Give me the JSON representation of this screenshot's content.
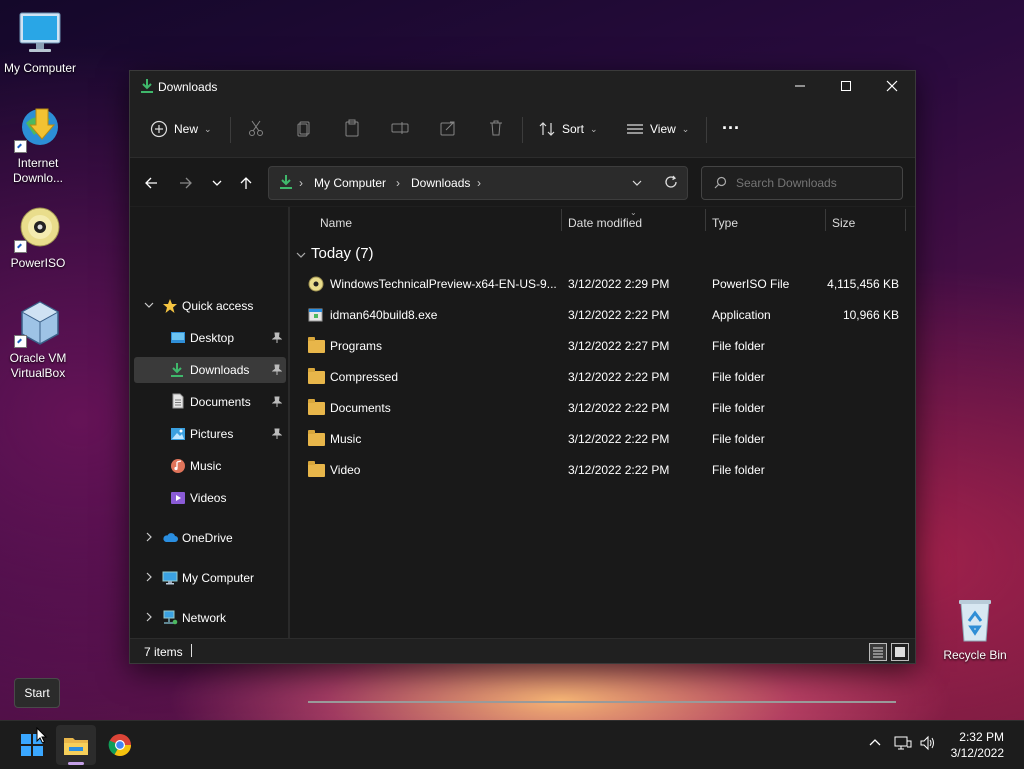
{
  "desktop": {
    "icons": [
      {
        "label": "My Computer"
      },
      {
        "label": "Internet Downlo..."
      },
      {
        "label": "PowerISO"
      },
      {
        "label": "Oracle VM VirtualBox"
      },
      {
        "label": "Recycle Bin"
      }
    ]
  },
  "window": {
    "title": "Downloads",
    "toolbar": {
      "new_label": "New",
      "sort_label": "Sort",
      "view_label": "View",
      "more_label": "..."
    },
    "address": {
      "crumbs": [
        "My Computer",
        "Downloads"
      ]
    },
    "search": {
      "placeholder": "Search Downloads"
    },
    "nav": {
      "quick_access": "Quick access",
      "items": [
        {
          "label": "Desktop",
          "pinned": true
        },
        {
          "label": "Downloads",
          "pinned": true,
          "selected": true
        },
        {
          "label": "Documents",
          "pinned": true
        },
        {
          "label": "Pictures",
          "pinned": true
        },
        {
          "label": "Music",
          "pinned": false
        },
        {
          "label": "Videos",
          "pinned": false
        }
      ],
      "onedrive": "OneDrive",
      "my_computer": "My Computer",
      "network": "Network"
    },
    "columns": {
      "name": "Name",
      "date": "Date modified",
      "type": "Type",
      "size": "Size"
    },
    "group_label": "Today (7)",
    "files": [
      {
        "name": "WindowsTechnicalPreview-x64-EN-US-9...",
        "date": "3/12/2022 2:29 PM",
        "type": "PowerISO File",
        "size": "4,115,456 KB",
        "icon": "disc-icon"
      },
      {
        "name": "idman640build8.exe",
        "date": "3/12/2022 2:22 PM",
        "type": "Application",
        "size": "10,966 KB",
        "icon": "exe-icon"
      },
      {
        "name": "Programs",
        "date": "3/12/2022 2:27 PM",
        "type": "File folder",
        "size": "",
        "icon": "folder-icon"
      },
      {
        "name": "Compressed",
        "date": "3/12/2022 2:22 PM",
        "type": "File folder",
        "size": "",
        "icon": "folder-icon"
      },
      {
        "name": "Documents",
        "date": "3/12/2022 2:22 PM",
        "type": "File folder",
        "size": "",
        "icon": "folder-icon"
      },
      {
        "name": "Music",
        "date": "3/12/2022 2:22 PM",
        "type": "File folder",
        "size": "",
        "icon": "folder-icon"
      },
      {
        "name": "Video",
        "date": "3/12/2022 2:22 PM",
        "type": "File folder",
        "size": "",
        "icon": "folder-icon"
      }
    ],
    "status": {
      "items_count": "7 items"
    }
  },
  "taskbar": {
    "tooltip": "Start",
    "time": "2:32 PM",
    "date": "3/12/2022"
  },
  "colors": {
    "window_bg": "#1f1f1f",
    "accent_download": "#3fb86b",
    "folder": "#e8b64a",
    "taskbar": "#1c1c1c"
  }
}
